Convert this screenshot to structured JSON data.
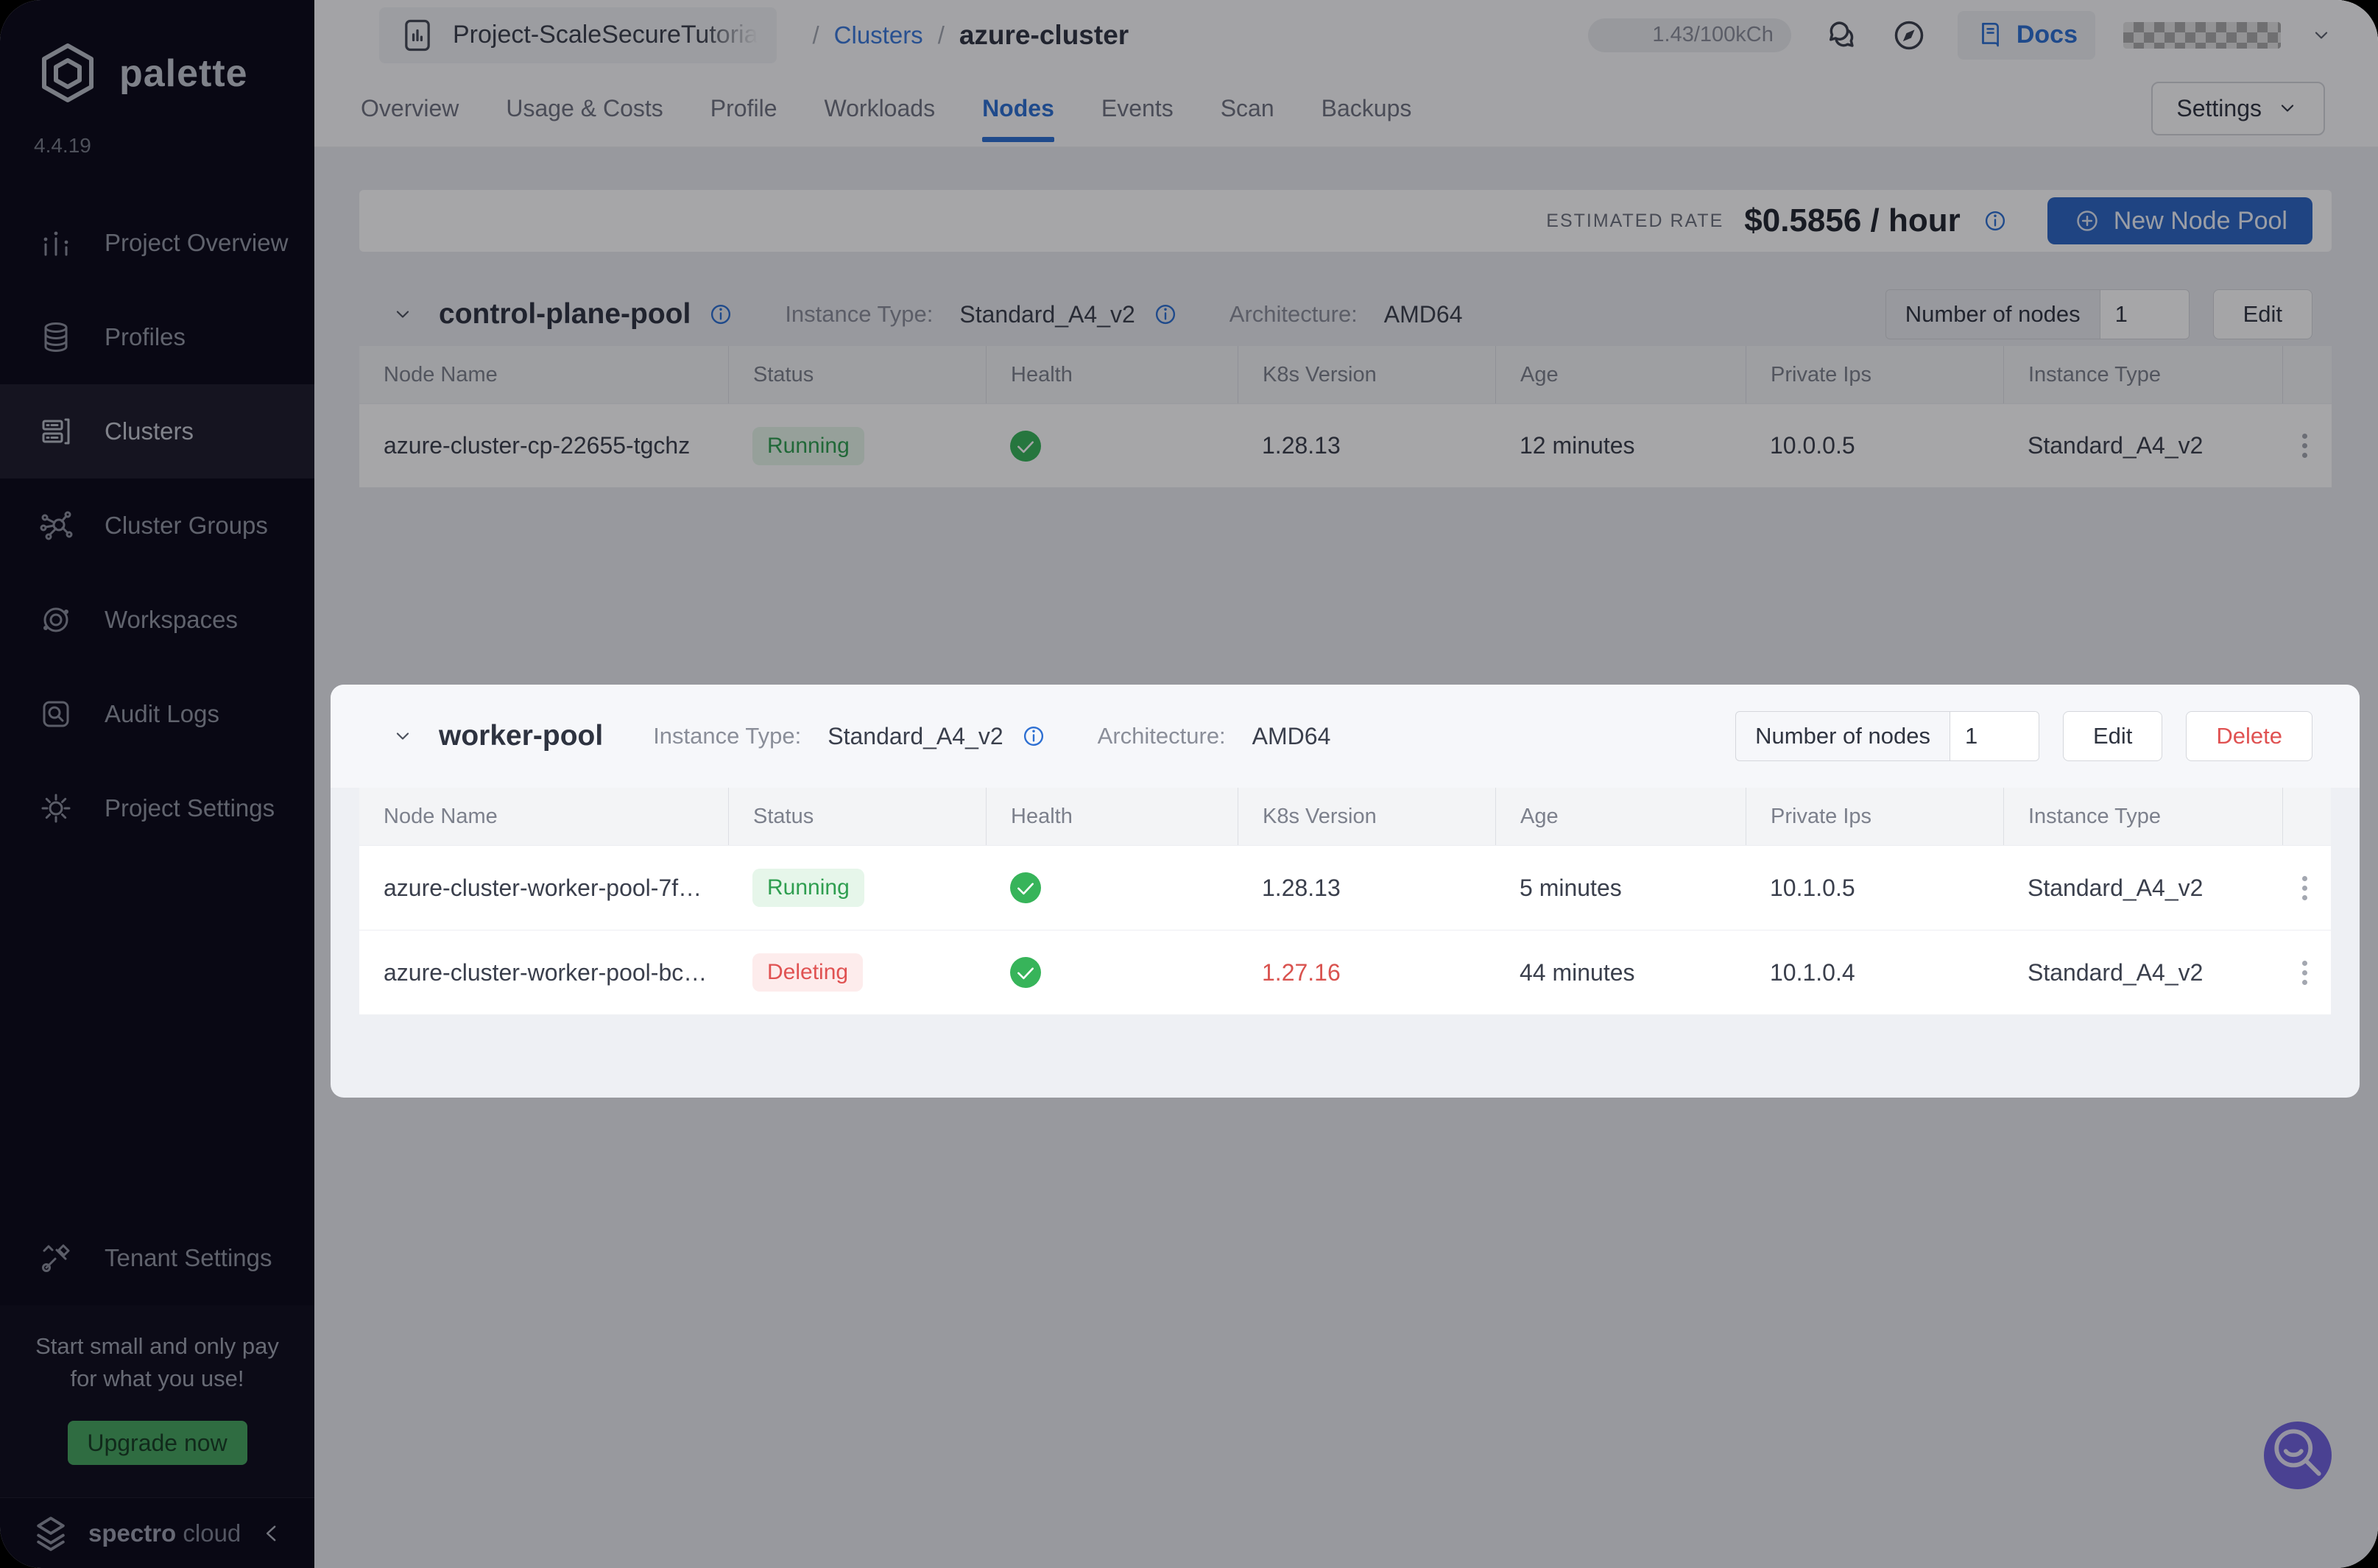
{
  "colors": {
    "accent_blue": "#2d6fd2",
    "button_blue": "#2d66c4",
    "success_green": "#37b45a",
    "danger_red": "#e05252",
    "upgrade_green": "#46a55f",
    "fab_purple": "#6f61dd",
    "sidebar_bg": "#0a0818"
  },
  "sidebar": {
    "brand": "palette",
    "version": "4.4.19",
    "items": [
      {
        "label": "Project Overview",
        "icon": "bar-chart-icon"
      },
      {
        "label": "Profiles",
        "icon": "layers-icon"
      },
      {
        "label": "Clusters",
        "icon": "server-icon"
      },
      {
        "label": "Cluster Groups",
        "icon": "network-icon"
      },
      {
        "label": "Workspaces",
        "icon": "orbit-icon"
      },
      {
        "label": "Audit Logs",
        "icon": "audit-magnifier-icon"
      },
      {
        "label": "Project Settings",
        "icon": "gear-icon"
      }
    ],
    "tenant_settings": "Tenant Settings",
    "promo_line1": "Start small and only pay",
    "promo_line2": "for what you use!",
    "upgrade": "Upgrade now",
    "footer_brand_bold": "spectro",
    "footer_brand_light": "cloud"
  },
  "header": {
    "project": "Project-ScaleSecureTutoria",
    "sep": "/",
    "link": "Clusters",
    "current": "azure-cluster",
    "usage": "1.43/100kCh",
    "docs": "Docs"
  },
  "tabs": {
    "labels": [
      "Overview",
      "Usage & Costs",
      "Profile",
      "Workloads",
      "Nodes",
      "Events",
      "Scan",
      "Backups"
    ],
    "active": "Nodes",
    "settings": "Settings"
  },
  "toolbar": {
    "rate_label": "ESTIMATED RATE",
    "rate": "$0.5856 / hour",
    "new_pool": "New Node Pool"
  },
  "table": {
    "columns": [
      "Node Name",
      "Status",
      "Health",
      "K8s Version",
      "Age",
      "Private Ips",
      "Instance Type"
    ]
  },
  "pools": {
    "cp": {
      "name": "control-plane-pool",
      "it_label": "Instance Type:",
      "it": "Standard_A4_v2",
      "arch_label": "Architecture:",
      "arch": "AMD64",
      "nodes_label": "Number of nodes",
      "nodes": "1",
      "edit": "Edit",
      "rows": [
        {
          "name": "azure-cluster-cp-22655-tgchz",
          "status": "Running",
          "k8s": "1.28.13",
          "age": "12 minutes",
          "ip": "10.0.0.5",
          "instance": "Standard_A4_v2"
        }
      ]
    },
    "worker": {
      "name": "worker-pool",
      "it_label": "Instance Type:",
      "it": "Standard_A4_v2",
      "arch_label": "Architecture:",
      "arch": "AMD64",
      "nodes_label": "Number of nodes",
      "nodes": "1",
      "edit": "Edit",
      "delete": "Delete",
      "rows": [
        {
          "name": "azure-cluster-worker-pool-7f…",
          "status": "Running",
          "k8s": "1.28.13",
          "age": "5 minutes",
          "ip": "10.1.0.5",
          "instance": "Standard_A4_v2"
        },
        {
          "name": "azure-cluster-worker-pool-bc…",
          "status": "Deleting",
          "k8s": "1.27.16",
          "age": "44 minutes",
          "ip": "10.1.0.4",
          "instance": "Standard_A4_v2"
        }
      ]
    }
  }
}
